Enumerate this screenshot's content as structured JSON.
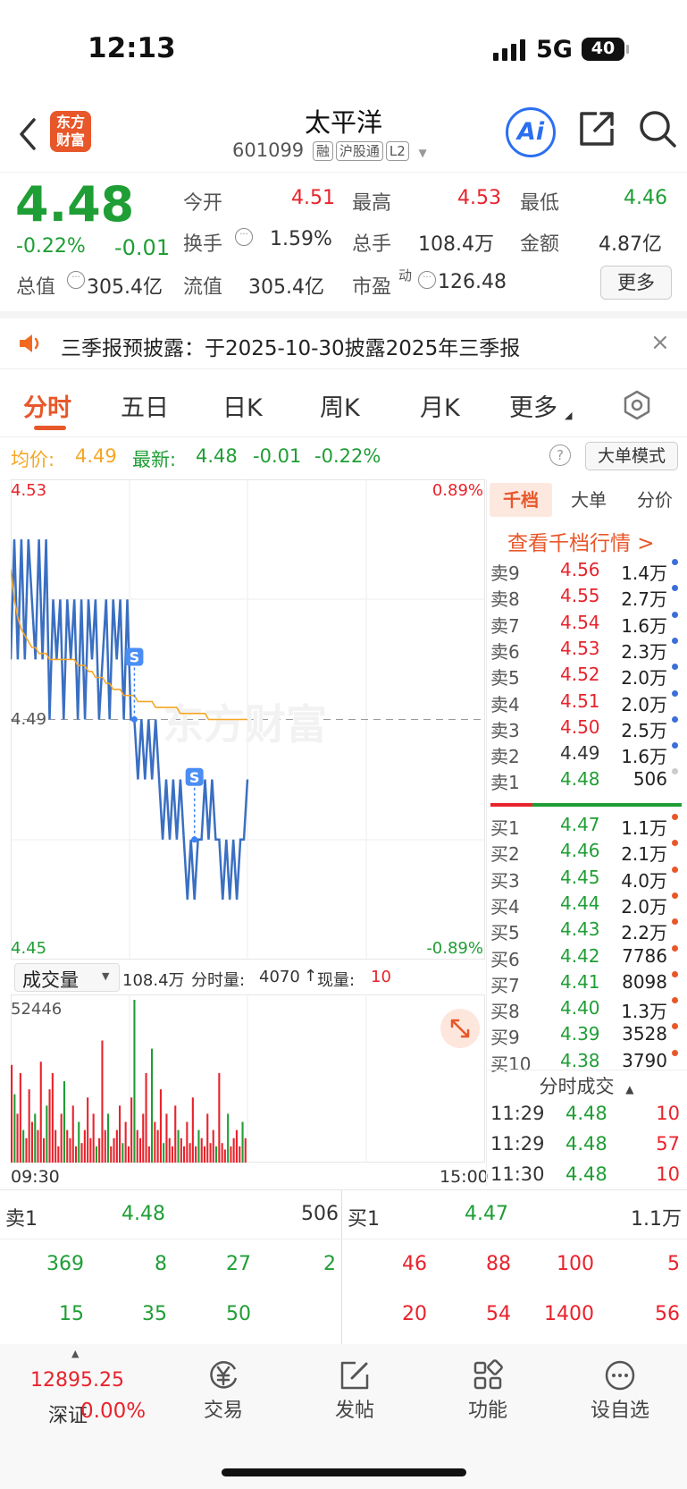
{
  "status_bar": {
    "time": "12:13",
    "network": "5G",
    "battery": "40"
  },
  "header": {
    "logo_line1": "东方",
    "logo_line2": "财富",
    "title": "太平洋",
    "code": "601099",
    "tags": [
      "融",
      "沪股通",
      "L2"
    ],
    "ai_label": "Ai"
  },
  "quote": {
    "price": "4.48",
    "change_pct": "-0.22%",
    "change": "-0.01",
    "open_label": "今开",
    "open": "4.51",
    "high_label": "最高",
    "high": "4.53",
    "low_label": "最低",
    "low": "4.46",
    "turnover_label": "换手",
    "turnover": "1.59%",
    "volume_label": "总手",
    "volume": "108.4万",
    "amount_label": "金额",
    "amount": "4.87亿",
    "mktcap_label": "总值",
    "mktcap": "305.4亿",
    "float_label": "流值",
    "float_cap": "305.4亿",
    "pe_label": "市盈",
    "pe_sup": "动",
    "pe": "126.48",
    "more_btn": "更多"
  },
  "notice": {
    "text": "三季报预披露：于2025-10-30披露2025年三季报"
  },
  "tabs": [
    "分时",
    "五日",
    "日K",
    "周K",
    "月K",
    "更多"
  ],
  "chart_info": {
    "avg_label": "均价:",
    "avg": "4.49",
    "latest_label": "最新:",
    "latest": "4.48",
    "latest_change": "-0.01",
    "latest_pct": "-0.22%",
    "mode_btn": "大单模式",
    "help": "?"
  },
  "chart_data": {
    "type": "line",
    "y_max_label": "4.53",
    "y_mid_label": "4.49",
    "y_min_label": "4.45",
    "pct_max_label": "0.89%",
    "pct_min_label": "-0.89%",
    "ylim": [
      4.45,
      4.53
    ],
    "series": [
      {
        "values": [
          4.5,
          4.52,
          4.5,
          4.52,
          4.5,
          4.52,
          4.51,
          4.5,
          4.52,
          4.5,
          4.52,
          4.49,
          4.51,
          4.5,
          4.51,
          4.49,
          4.51,
          4.5,
          4.51,
          4.49,
          4.51,
          4.49,
          4.51,
          4.5,
          4.51,
          4.49,
          4.5,
          4.51,
          4.49,
          4.51,
          4.5,
          4.51,
          4.49,
          4.51,
          4.49,
          4.49,
          4.48,
          4.49,
          4.48,
          4.49,
          4.48,
          4.49,
          4.48,
          4.47,
          4.48,
          4.47,
          4.48,
          4.47,
          4.48,
          4.47,
          4.46,
          4.47,
          4.46,
          4.47,
          4.47,
          4.48,
          4.47,
          4.48,
          4.47,
          4.47,
          4.46,
          4.47,
          4.46,
          4.47,
          4.46,
          4.47,
          4.47,
          4.48
        ]
      },
      {
        "values": [
          4.515,
          4.51,
          4.507,
          4.505,
          4.504,
          4.503,
          4.502,
          4.502,
          4.501,
          4.501,
          4.501,
          4.5,
          4.5,
          4.5,
          4.5,
          4.5,
          4.5,
          4.5,
          4.5,
          4.499,
          4.499,
          4.499,
          4.498,
          4.498,
          4.497,
          4.497,
          4.497,
          4.496,
          4.496,
          4.495,
          4.495,
          4.495,
          4.494,
          4.494,
          4.494,
          4.494,
          4.493,
          4.493,
          4.493,
          4.493,
          4.493,
          4.492,
          4.492,
          4.492,
          4.492,
          4.492,
          4.492,
          4.492,
          4.491,
          4.491,
          4.491,
          4.491,
          4.491,
          4.491,
          4.491,
          4.491,
          4.49,
          4.49,
          4.49,
          4.49,
          4.49,
          4.49,
          4.49,
          4.49,
          4.49,
          4.49,
          4.49,
          4.49
        ]
      }
    ],
    "markers": [
      {
        "label": "S",
        "index": 35,
        "value": 4.49
      },
      {
        "label": "S",
        "index": 52,
        "value": 4.47
      }
    ]
  },
  "volume_panel": {
    "selector": "成交量",
    "total": "108.4万",
    "tick_label": "分时量:",
    "tick_vol": "4070",
    "now_label": "现量:",
    "now_vol": "10",
    "max_label": "52446",
    "time_start": "09:30",
    "time_end": "15:00",
    "bars": [
      {
        "v": 0.6,
        "c": "r"
      },
      {
        "v": 0.42,
        "c": "g"
      },
      {
        "v": 0.3,
        "c": "r"
      },
      {
        "v": 0.55,
        "c": "r"
      },
      {
        "v": 0.2,
        "c": "g"
      },
      {
        "v": 0.15,
        "c": "r"
      },
      {
        "v": 0.45,
        "c": "r"
      },
      {
        "v": 0.25,
        "c": "r"
      },
      {
        "v": 0.3,
        "c": "g"
      },
      {
        "v": 0.2,
        "c": "r"
      },
      {
        "v": 0.62,
        "c": "r"
      },
      {
        "v": 0.15,
        "c": "r"
      },
      {
        "v": 0.35,
        "c": "g"
      },
      {
        "v": 0.45,
        "c": "r"
      },
      {
        "v": 0.55,
        "c": "r"
      },
      {
        "v": 0.2,
        "c": "r"
      },
      {
        "v": 0.1,
        "c": "r"
      },
      {
        "v": 0.3,
        "c": "r"
      },
      {
        "v": 0.5,
        "c": "g"
      },
      {
        "v": 0.2,
        "c": "r"
      },
      {
        "v": 0.15,
        "c": "r"
      },
      {
        "v": 0.35,
        "c": "r"
      },
      {
        "v": 0.1,
        "c": "r"
      },
      {
        "v": 0.25,
        "c": "g"
      },
      {
        "v": 0.12,
        "c": "r"
      },
      {
        "v": 0.2,
        "c": "r"
      },
      {
        "v": 0.4,
        "c": "r"
      },
      {
        "v": 0.15,
        "c": "r"
      },
      {
        "v": 0.3,
        "c": "r"
      },
      {
        "v": 0.1,
        "c": "g"
      },
      {
        "v": 0.15,
        "c": "r"
      },
      {
        "v": 0.75,
        "c": "r"
      },
      {
        "v": 0.2,
        "c": "r"
      },
      {
        "v": 0.3,
        "c": "g"
      },
      {
        "v": 0.1,
        "c": "r"
      },
      {
        "v": 0.15,
        "c": "r"
      },
      {
        "v": 0.2,
        "c": "r"
      },
      {
        "v": 0.35,
        "c": "r"
      },
      {
        "v": 0.12,
        "c": "g"
      },
      {
        "v": 0.25,
        "c": "r"
      },
      {
        "v": 0.1,
        "c": "r"
      },
      {
        "v": 0.4,
        "c": "r"
      },
      {
        "v": 1.0,
        "c": "g"
      },
      {
        "v": 0.2,
        "c": "r"
      },
      {
        "v": 0.15,
        "c": "r"
      },
      {
        "v": 0.3,
        "c": "r"
      },
      {
        "v": 0.55,
        "c": "r"
      },
      {
        "v": 0.1,
        "c": "r"
      },
      {
        "v": 0.7,
        "c": "g"
      },
      {
        "v": 0.25,
        "c": "r"
      },
      {
        "v": 0.2,
        "c": "r"
      },
      {
        "v": 0.45,
        "c": "r"
      },
      {
        "v": 0.12,
        "c": "g"
      },
      {
        "v": 0.3,
        "c": "r"
      },
      {
        "v": 0.15,
        "c": "r"
      },
      {
        "v": 0.1,
        "c": "r"
      },
      {
        "v": 0.35,
        "c": "r"
      },
      {
        "v": 0.2,
        "c": "g"
      },
      {
        "v": 0.15,
        "c": "r"
      },
      {
        "v": 0.1,
        "c": "r"
      },
      {
        "v": 0.25,
        "c": "r"
      },
      {
        "v": 0.12,
        "c": "r"
      },
      {
        "v": 0.4,
        "c": "r"
      },
      {
        "v": 0.1,
        "c": "r"
      },
      {
        "v": 0.2,
        "c": "g"
      },
      {
        "v": 0.15,
        "c": "r"
      },
      {
        "v": 0.1,
        "c": "r"
      },
      {
        "v": 0.3,
        "c": "r"
      },
      {
        "v": 0.12,
        "c": "r"
      },
      {
        "v": 0.2,
        "c": "r"
      },
      {
        "v": 0.1,
        "c": "g"
      },
      {
        "v": 0.55,
        "c": "r"
      },
      {
        "v": 0.12,
        "c": "r"
      },
      {
        "v": 0.08,
        "c": "r"
      },
      {
        "v": 0.3,
        "c": "g"
      },
      {
        "v": 0.1,
        "c": "r"
      },
      {
        "v": 0.15,
        "c": "r"
      },
      {
        "v": 0.2,
        "c": "r"
      },
      {
        "v": 0.1,
        "c": "r"
      },
      {
        "v": 0.25,
        "c": "g"
      },
      {
        "v": 0.15,
        "c": "r"
      }
    ]
  },
  "orderbook": {
    "tabs": [
      "千档",
      "大单",
      "分价"
    ],
    "link": "查看千档行情 >",
    "asks": [
      {
        "label": "卖9",
        "price": "4.56",
        "vol": "1.4万",
        "pc": "red"
      },
      {
        "label": "卖8",
        "price": "4.55",
        "vol": "2.7万",
        "pc": "red"
      },
      {
        "label": "卖7",
        "price": "4.54",
        "vol": "1.6万",
        "pc": "red"
      },
      {
        "label": "卖6",
        "price": "4.53",
        "vol": "2.3万",
        "pc": "red"
      },
      {
        "label": "卖5",
        "price": "4.52",
        "vol": "2.0万",
        "pc": "red"
      },
      {
        "label": "卖4",
        "price": "4.51",
        "vol": "2.0万",
        "pc": "red"
      },
      {
        "label": "卖3",
        "price": "4.50",
        "vol": "2.5万",
        "pc": "red"
      },
      {
        "label": "卖2",
        "price": "4.49",
        "vol": "1.6万",
        "pc": "gray"
      },
      {
        "label": "卖1",
        "price": "4.48",
        "vol": "506",
        "pc": "green"
      }
    ],
    "bids": [
      {
        "label": "买1",
        "price": "4.47",
        "vol": "1.1万"
      },
      {
        "label": "买2",
        "price": "4.46",
        "vol": "2.1万"
      },
      {
        "label": "买3",
        "price": "4.45",
        "vol": "4.0万"
      },
      {
        "label": "买4",
        "price": "4.44",
        "vol": "2.0万"
      },
      {
        "label": "买5",
        "price": "4.43",
        "vol": "2.2万"
      },
      {
        "label": "买6",
        "price": "4.42",
        "vol": "7786"
      },
      {
        "label": "买7",
        "price": "4.41",
        "vol": "8098"
      },
      {
        "label": "买8",
        "price": "4.40",
        "vol": "1.3万"
      },
      {
        "label": "买9",
        "price": "4.39",
        "vol": "3528"
      },
      {
        "label": "买10",
        "price": "4.38",
        "vol": "3790"
      }
    ],
    "trades_header": "分时成交",
    "trades": [
      {
        "time": "11:29",
        "price": "4.48",
        "vol": "10",
        "vc": "red"
      },
      {
        "time": "11:29",
        "price": "4.48",
        "vol": "57",
        "vc": "red"
      },
      {
        "time": "11:30",
        "price": "4.48",
        "vol": "10",
        "vc": "red"
      }
    ]
  },
  "depth": {
    "sell_label": "卖1",
    "sell_price": "4.48",
    "sell_vol": "506",
    "buy_label": "买1",
    "buy_price": "4.47",
    "buy_vol": "1.1万",
    "sell_row1": [
      "369",
      "8",
      "27",
      "2"
    ],
    "sell_row2": [
      "15",
      "35",
      "50"
    ],
    "buy_row1": [
      "46",
      "88",
      "100",
      "5"
    ],
    "buy_row2": [
      "20",
      "54",
      "1400",
      "56"
    ]
  },
  "bottom_nav": {
    "index_value": "12895.25",
    "index_name": "深证",
    "index_pct": "0.00%",
    "items": [
      "交易",
      "发帖",
      "功能",
      "设自选"
    ]
  }
}
